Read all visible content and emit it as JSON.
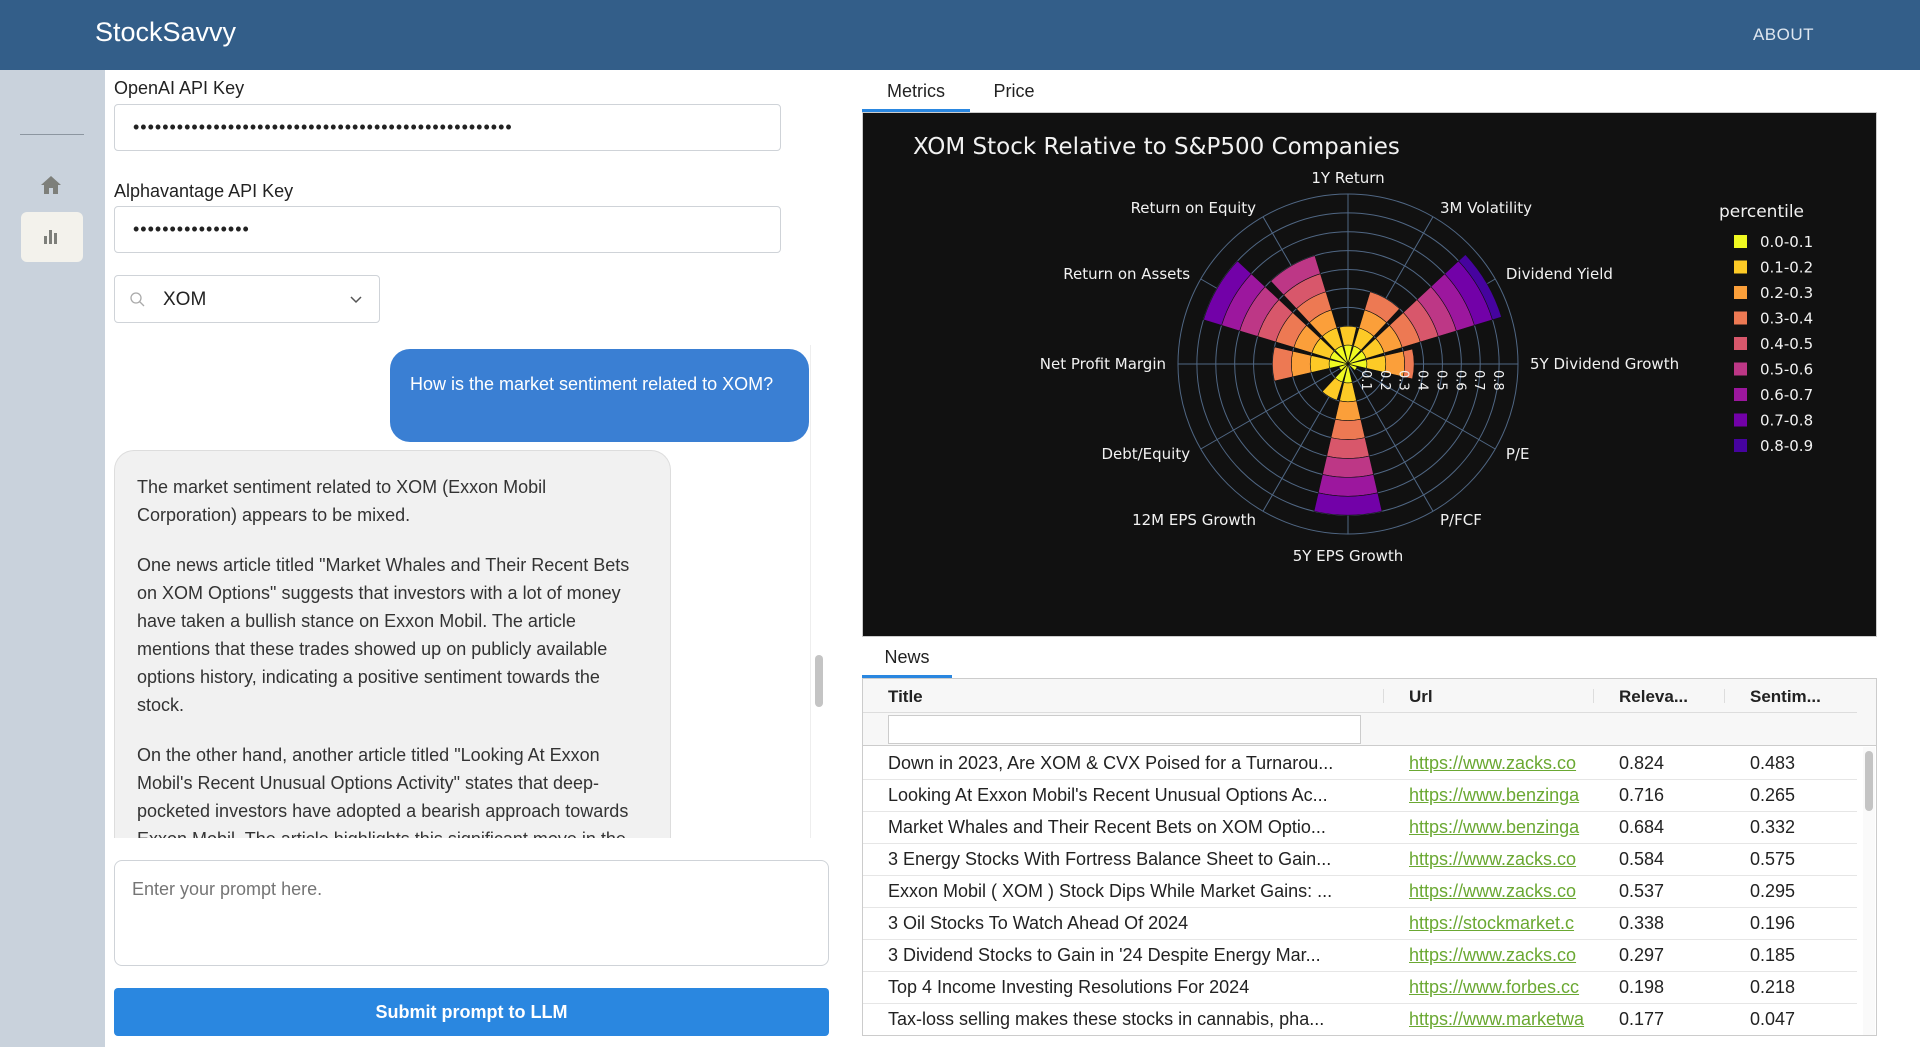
{
  "header": {
    "brand": "StockSavvy",
    "about": "ABOUT"
  },
  "sidebar": {
    "items": [
      {
        "icon": "home-icon"
      },
      {
        "icon": "bar-chart-icon",
        "active": true
      }
    ]
  },
  "form": {
    "openai_label": "OpenAI API Key",
    "openai_value": "••••••••••••••••••••••••••••••••••••••••••••••••••••",
    "alpha_label": "Alphavantage API Key",
    "alpha_value": "••••••••••••••••",
    "ticker_value": "XOM"
  },
  "chat": {
    "user_message": "How is the market sentiment related to XOM?",
    "assistant_paragraphs": [
      "The market sentiment related to XOM (Exxon Mobil Corporation) appears to be mixed.",
      "One news article titled \"Market Whales and Their Recent Bets on XOM Options\" suggests that investors with a lot of money have taken a bullish stance on Exxon Mobil. The article mentions that these trades showed up on publicly available options history, indicating a positive sentiment towards the stock.",
      "On the other hand, another article titled \"Looking At Exxon Mobil's Recent Unusual Options Activity\" states that deep-pocketed investors have adopted a bearish approach towards Exxon Mobil. The article highlights this significant move in the"
    ],
    "prompt_placeholder": "Enter your prompt here.",
    "submit_label": "Submit prompt to LLM"
  },
  "tabs": {
    "metrics": "Metrics",
    "price": "Price",
    "news": "News"
  },
  "chart_data": {
    "type": "barpolar",
    "title": "XOM Stock Relative to S&P500 Companies",
    "categories": [
      "1Y Return",
      "3M Volatility",
      "Dividend Yield",
      "5Y Dividend Growth",
      "P/E",
      "P/FCF",
      "5Y EPS Growth",
      "12M EPS Growth",
      "Debt/Equity",
      "Net Profit Margin",
      "Return on Assets",
      "Return on Equity"
    ],
    "values": [
      0.2,
      0.4,
      0.85,
      0.35,
      0.05,
      0.0,
      0.8,
      0.2,
      0.05,
      0.4,
      0.8,
      0.6
    ],
    "radial_ticks": [
      "0.1",
      "0.2",
      "0.3",
      "0.4",
      "0.5",
      "0.6",
      "0.7",
      "0.8"
    ],
    "rlim": [
      0,
      0.9
    ],
    "legend_title": "percentile",
    "legend": [
      "0.0-0.1",
      "0.1-0.2",
      "0.2-0.3",
      "0.3-0.4",
      "0.4-0.5",
      "0.5-0.6",
      "0.6-0.7",
      "0.7-0.8",
      "0.8-0.9"
    ],
    "colors": [
      "#f0f921",
      "#fdca26",
      "#fb9f3a",
      "#ed7953",
      "#d8576b",
      "#bd3786",
      "#9c179e",
      "#7201a8",
      "#46039f"
    ],
    "legend_placement": "right"
  },
  "news": {
    "columns": [
      "Title",
      "Url",
      "Releva...",
      "Sentim..."
    ],
    "rows": [
      [
        "Down in 2023, Are XOM & CVX Poised for a Turnarou...",
        "https://www.zacks.co",
        "0.824",
        "0.483"
      ],
      [
        "Looking At Exxon Mobil's Recent Unusual Options Ac...",
        "https://www.benzinga",
        "0.716",
        "0.265"
      ],
      [
        "Market Whales and Their Recent Bets on XOM Optio...",
        "https://www.benzinga",
        "0.684",
        "0.332"
      ],
      [
        "3 Energy Stocks With Fortress Balance Sheet to Gain...",
        "https://www.zacks.co",
        "0.584",
        "0.575"
      ],
      [
        "Exxon Mobil ( XOM ) Stock Dips While Market Gains: ...",
        "https://www.zacks.co",
        "0.537",
        "0.295"
      ],
      [
        "3 Oil Stocks To Watch Ahead Of 2024",
        "https://stockmarket.c",
        "0.338",
        "0.196"
      ],
      [
        "3 Dividend Stocks to Gain in '24 Despite Energy Mar...",
        "https://www.zacks.co",
        "0.297",
        "0.185"
      ],
      [
        "Top 4 Income Investing Resolutions For 2024",
        "https://www.forbes.cc",
        "0.198",
        "0.218"
      ],
      [
        "Tax-loss selling makes these stocks in cannabis, pha...",
        "https://www.marketwa",
        "0.177",
        "0.047"
      ]
    ]
  }
}
